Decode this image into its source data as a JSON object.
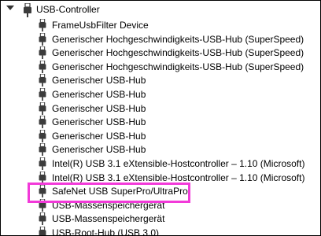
{
  "root": {
    "label": "USB-Controller",
    "icon": "usb-plug-icon",
    "expanded": true
  },
  "devices": [
    {
      "label": "FrameUsbFilter Device",
      "icon": "usb-plug-icon"
    },
    {
      "label": "Generischer Hochgeschwindigkeits-USB-Hub (SuperSpeed)",
      "icon": "usb-plug-icon"
    },
    {
      "label": "Generischer Hochgeschwindigkeits-USB-Hub (SuperSpeed)",
      "icon": "usb-plug-icon"
    },
    {
      "label": "Generischer Hochgeschwindigkeits-USB-Hub (SuperSpeed)",
      "icon": "usb-plug-icon"
    },
    {
      "label": "Generischer USB-Hub",
      "icon": "usb-plug-icon"
    },
    {
      "label": "Generischer USB-Hub",
      "icon": "usb-plug-icon"
    },
    {
      "label": "Generischer USB-Hub",
      "icon": "usb-plug-icon"
    },
    {
      "label": "Generischer USB-Hub",
      "icon": "usb-plug-icon"
    },
    {
      "label": "Generischer USB-Hub",
      "icon": "usb-plug-icon"
    },
    {
      "label": "Generischer USB-Hub",
      "icon": "usb-plug-icon"
    },
    {
      "label": "Intel(R) USB 3.1 eXtensible-Hostcontroller – 1.10 (Microsoft)",
      "icon": "usb-plug-icon"
    },
    {
      "label": "Intel(R) USB 3.1 eXtensible-Hostcontroller – 1.10 (Microsoft)",
      "icon": "usb-plug-icon"
    },
    {
      "label": "SafeNet USB SuperPro/UltraPro",
      "icon": "usb-plug-icon",
      "highlighted": true
    },
    {
      "label": "USB-Massenspeichergerät",
      "icon": "usb-plug-icon"
    },
    {
      "label": "USB-Massenspeichergerät",
      "icon": "usb-plug-icon"
    },
    {
      "label": "USB-Root-Hub (USB 3.0)",
      "icon": "usb-plug-icon"
    }
  ],
  "colors": {
    "highlight": "#f23ad9",
    "icon": "#3c3c3c"
  }
}
